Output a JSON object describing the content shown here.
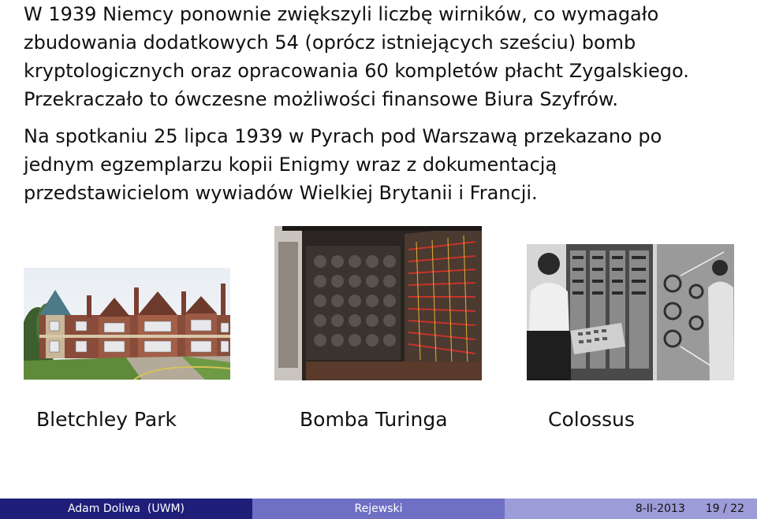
{
  "paragraphs": [
    "W 1939 Niemcy ponownie zwiększyli liczbę wirników, co wymagało\nzbudowania dodatkowych 54 (oprócz istniejących sześciu) bomb\nkryptologicznych oraz opracowania 60 kompletów płacht Zygalskiego.\nPrzekraczało to ówczesne możliwości finansowe Biura Szyfrów.",
    "Na spotkaniu 25 lipca 1939 w Pyrach pod Warszawą przekazano po\njednym egzemplarzu kopii Enigmy wraz z dokumentacją\nprzedstawicielom wywiadów Wielkiej Brytanii i Francji."
  ],
  "figures": [
    {
      "caption": "Bletchley Park"
    },
    {
      "caption": "Bomba Turinga"
    },
    {
      "caption": "Colossus"
    }
  ],
  "footer": {
    "author": "Adam Doliwa  (UWM)",
    "title": "Rejewski",
    "date": "8-II-2013",
    "page": "19 / 22"
  },
  "colors": {
    "footer_dark": "#1f1f7a",
    "footer_mid": "#6f6fc4",
    "footer_light": "#9c9cd8"
  }
}
